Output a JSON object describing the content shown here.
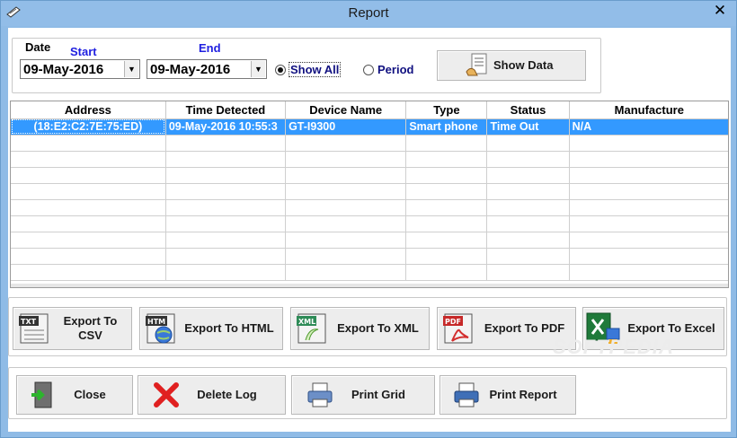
{
  "window": {
    "title": "Report",
    "close_glyph": "✕",
    "icon": "notepad-icon"
  },
  "date_group": {
    "legend": "Date",
    "start_label": "Start",
    "end_label": "End",
    "start_value": "09-May-2016",
    "end_value": "09-May-2016",
    "radio_show_all": "Show All",
    "radio_period": "Period",
    "show_all_selected": true,
    "show_data_button": "Show Data"
  },
  "grid": {
    "columns": [
      "Address",
      "Time Detected",
      "Device Name",
      "Type",
      "Status",
      "Manufacture"
    ],
    "rows": [
      [
        "(18:E2:C2:7E:75:ED)",
        "09-May-2016 10:55:3",
        "GT-I9300",
        "Smart phone",
        "Time Out",
        "N/A"
      ]
    ],
    "selection_color": "#3399ff"
  },
  "export": {
    "csv_line1": "Export To",
    "csv_line2": "CSV",
    "html": "Export To HTML",
    "xml": "Export To XML",
    "pdf": "Export To PDF",
    "excel": "Export To Excel",
    "icon_txt": "TXT",
    "icon_htm": "HTM",
    "icon_xml": "XML",
    "icon_pdf": "PDF"
  },
  "actions": {
    "close": "Close",
    "delete_log": "Delete Log",
    "print_grid": "Print Grid",
    "print_report": "Print Report"
  },
  "watermark": "SOFTPEDIA"
}
